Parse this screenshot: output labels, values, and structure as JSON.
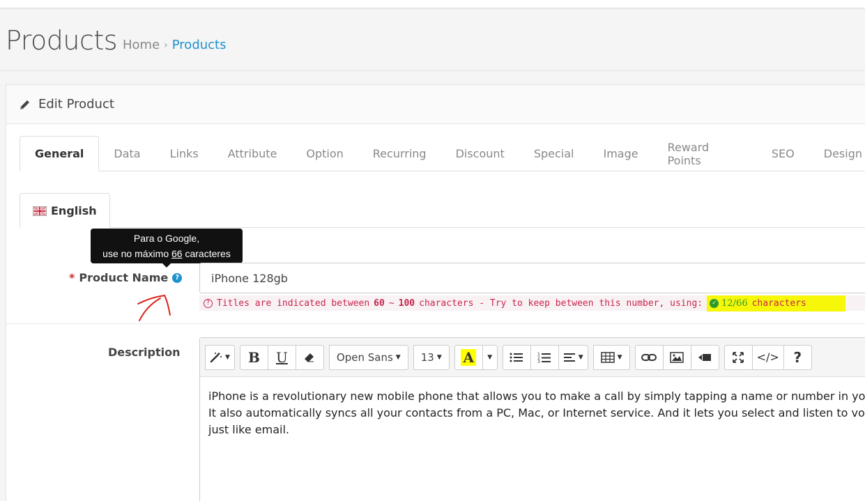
{
  "page": {
    "title": "Products",
    "breadcrumb": [
      {
        "label": "Home"
      },
      {
        "label": "Products"
      }
    ]
  },
  "panel": {
    "title": "Edit Product"
  },
  "tabs": [
    "General",
    "Data",
    "Links",
    "Attribute",
    "Option",
    "Recurring",
    "Discount",
    "Special",
    "Image",
    "Reward Points",
    "SEO",
    "Design"
  ],
  "active_tab": "General",
  "language_tab": "English",
  "tooltip": {
    "line1": "Para o Google,",
    "line2_prefix": "use no máximo",
    "line2_number": "66",
    "line2_suffix": "caracteres"
  },
  "product_name": {
    "required_mark": "*",
    "label": "Product Name",
    "help_icon": "question-circle-icon",
    "value": "iPhone 128gb"
  },
  "hint": {
    "prefix": "Titles are indicated between",
    "min": "60",
    "range_sep": "~",
    "max": "100",
    "middle": "characters - Try to keep between this number, using:",
    "count": "12/66",
    "suffix": "characters",
    "highlight_color": "#f7f709"
  },
  "description": {
    "label": "Description",
    "toolbar": {
      "font_family": "Open Sans",
      "font_size": "13",
      "icons": [
        "magic-icon",
        "bold-icon",
        "underline-icon",
        "eraser-icon",
        "font-color-icon",
        "unordered-list-icon",
        "ordered-list-icon",
        "align-icon",
        "table-icon",
        "link-icon",
        "picture-icon",
        "video-icon",
        "fullscreen-icon",
        "code-view-icon",
        "help-icon"
      ]
    },
    "lines": [
      "iPhone is a revolutionary new mobile phone that allows you to make a call by simply tapping a name or number in your addr",
      "It also automatically syncs all your contacts from a PC, Mac, or Internet service. And it lets you select and listen to voicemail m",
      "just like email."
    ]
  },
  "colors": {
    "accent": "#1e91cf",
    "required": "#c72f29",
    "hint_text": "#c7254e",
    "hint_bg": "#f9f2f4",
    "ok": "#2b9a2b"
  }
}
